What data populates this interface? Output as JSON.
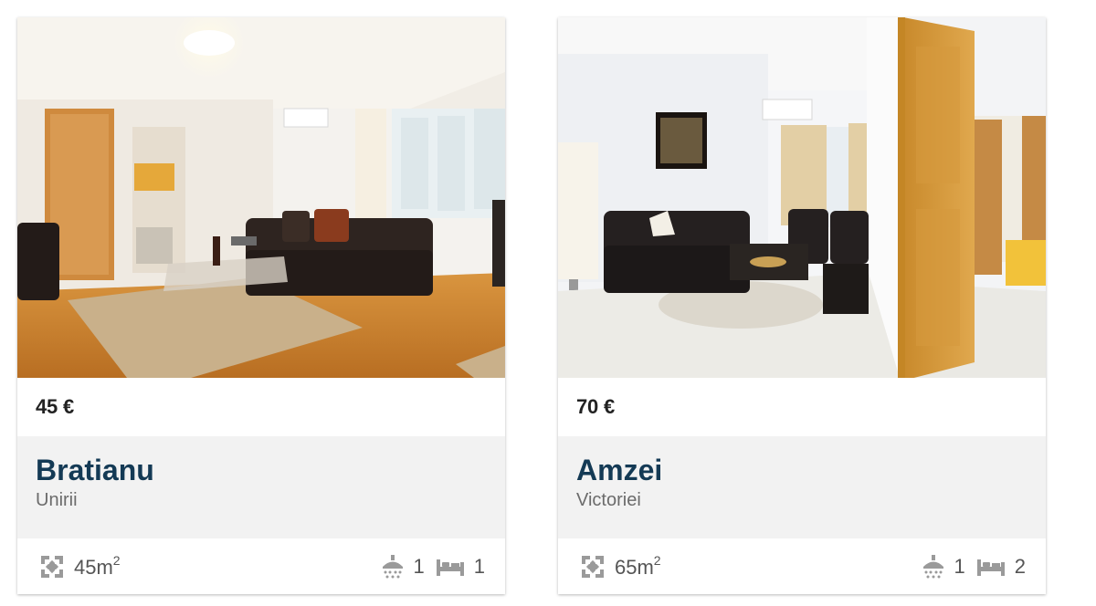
{
  "listings": [
    {
      "photo_alt": "Bratianu apartment living room",
      "price": "45 €",
      "title": "Bratianu",
      "area": "Unirii",
      "size": "45m",
      "size_unit_sup": "2",
      "bathrooms": "1",
      "bedrooms": "1",
      "icons": {
        "size": "expand-arrows-icon",
        "bath": "shower-icon",
        "bed": "bed-icon"
      }
    },
    {
      "photo_alt": "Amzei apartment living room",
      "price": "70 €",
      "title": "Amzei",
      "area": "Victoriei",
      "size": "65m",
      "size_unit_sup": "2",
      "bathrooms": "1",
      "bedrooms": "2",
      "icons": {
        "size": "expand-arrows-icon",
        "bath": "shower-icon",
        "bed": "bed-icon"
      }
    }
  ],
  "colors": {
    "title": "#143a55",
    "info_background": "#f2f2f2",
    "icon": "#9a9a9a"
  }
}
